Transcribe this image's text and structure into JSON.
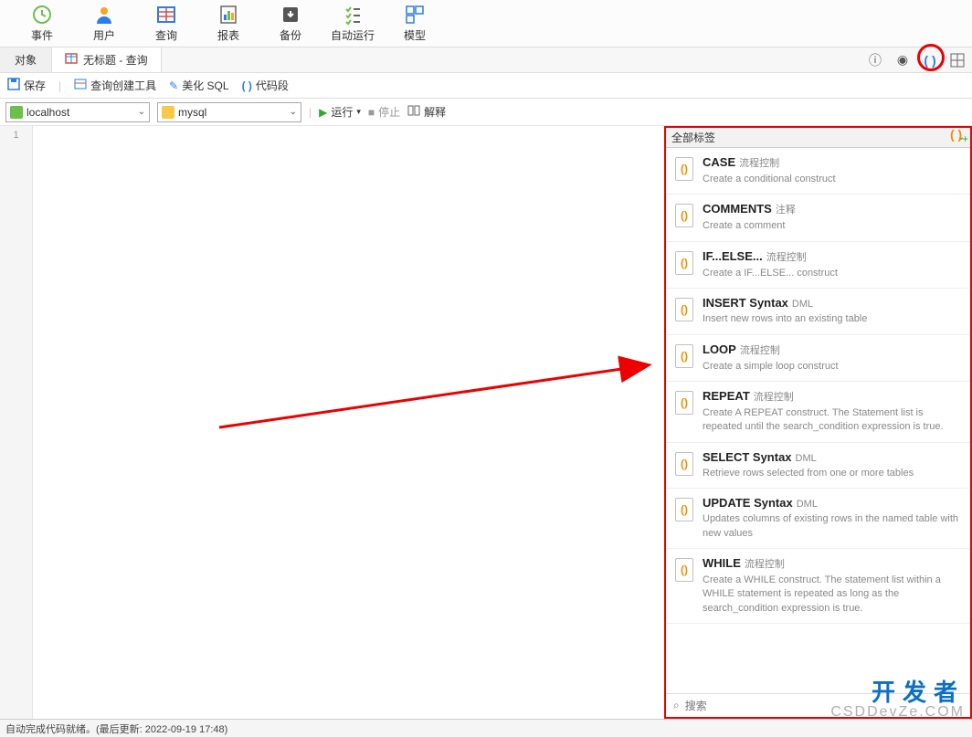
{
  "toolbar": {
    "event": "事件",
    "user": "用户",
    "query": "查询",
    "report": "报表",
    "backup": "备份",
    "autorun": "自动运行",
    "model": "模型"
  },
  "tabs": {
    "objects": "对象",
    "untitled_query": "无标题 - 查询"
  },
  "secondary": {
    "save": "保存",
    "query_builder": "查询创建工具",
    "beautify_sql": "美化 SQL",
    "code_snippet": "代码段"
  },
  "connections": {
    "host": "localhost",
    "db": "mysql"
  },
  "controls": {
    "run": "运行",
    "stop": "停止",
    "explain": "解释"
  },
  "editor": {
    "line1": "1"
  },
  "right_panel": {
    "label_all": "全部标签",
    "search_placeholder": "搜索",
    "snippets": [
      {
        "title": "CASE",
        "tag": "流程控制",
        "desc": "Create a conditional construct"
      },
      {
        "title": "COMMENTS",
        "tag": "注释",
        "desc": "Create a comment"
      },
      {
        "title": "IF...ELSE...",
        "tag": "流程控制",
        "desc": "Create a IF...ELSE... construct"
      },
      {
        "title": "INSERT Syntax",
        "tag": "DML",
        "desc": "Insert new rows into an existing table"
      },
      {
        "title": "LOOP",
        "tag": "流程控制",
        "desc": "Create a simple loop construct"
      },
      {
        "title": "REPEAT",
        "tag": "流程控制",
        "desc": "Create A REPEAT construct. The Statement list is repeated until the search_condition expression is true."
      },
      {
        "title": "SELECT Syntax",
        "tag": "DML",
        "desc": "Retrieve rows selected from one or more tables"
      },
      {
        "title": "UPDATE Syntax",
        "tag": "DML",
        "desc": "Updates columns of existing rows in the named table with new values"
      },
      {
        "title": "WHILE",
        "tag": "流程控制",
        "desc": "Create a WHILE construct. The statement list within a WHILE statement is repeated as long as the search_condition expression is true."
      }
    ]
  },
  "status": {
    "text": "自动完成代码就绪。(最后更新: 2022-09-19 17:48)"
  },
  "watermark": {
    "line1": "开发者",
    "line2": "CSDDevZe.COM"
  }
}
